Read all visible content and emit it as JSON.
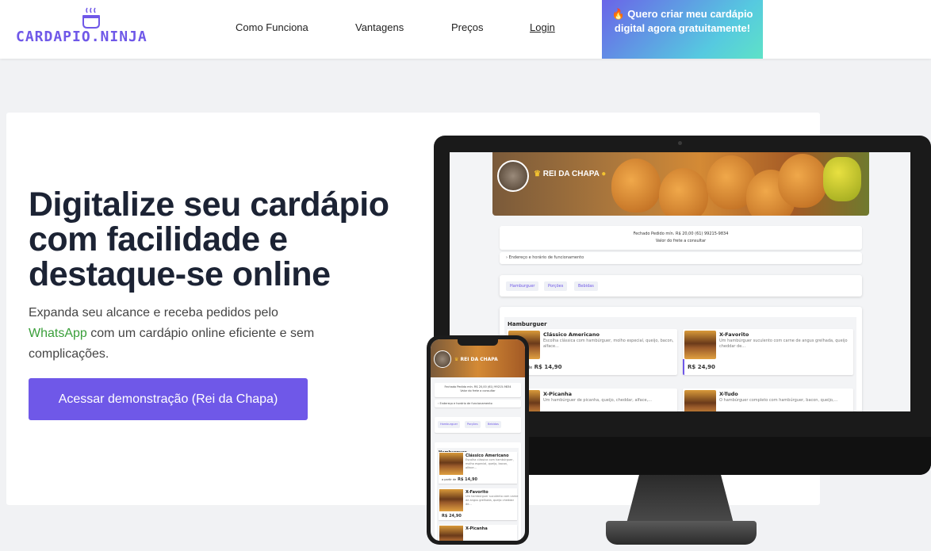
{
  "header": {
    "logo_text": "CARDAPIO.NINJA",
    "nav": [
      "Como Funciona",
      "Vantagens",
      "Preços",
      "Login"
    ],
    "cta": "Quero criar meu cardápio digital agora gratuitamente!"
  },
  "hero": {
    "title": "Digitalize seu cardápio com facilidade e destaque-se online",
    "subtitle_pre": "Expanda seu alcance e receba pedidos pelo ",
    "subtitle_highlight": "WhatsApp",
    "subtitle_post": " com um cardápio online eficiente e sem complicações.",
    "demo_button": "Acessar demonstração (Rei da Chapa)"
  },
  "preview": {
    "store_name": "REI DA CHAPA",
    "info_line": "Fechado  Pedido mín. R$ 20,00  (61) 99215-9834",
    "freight_line": "Valor do frete a consultar",
    "address_line": "Endereço e horário de funcionamento",
    "categories": [
      "Hamburguer",
      "Porções",
      "Bebidas"
    ],
    "section": "Hamburguer",
    "items": [
      {
        "name": "Clássico Americano",
        "desc": "Escolha clássica com hambúrguer, molho especial, queijo, bacon, alface...",
        "price": "R$ 14,90",
        "price_prefix": "a partir de"
      },
      {
        "name": "X-Favorito",
        "desc": "Um hambúrguer suculento com carne de angus grelhada, queijo cheddar de...",
        "price": "R$ 24,90"
      },
      {
        "name": "X-Picanha",
        "desc": "Um hambúrguer de picanha, queijo, cheddar, alface,...",
        "price": ""
      },
      {
        "name": "X-Tudo",
        "desc": "O hambúrguer completo com hambúrguer, bacon, queijo,...",
        "price": ""
      }
    ],
    "phone_items": [
      {
        "name": "Clássico Americano",
        "desc": "Escolha clássica com hambúrguer, molho especial, queijo, bacon, alface...",
        "price": "R$ 14,90",
        "price_prefix": "a partir de"
      },
      {
        "name": "X-Favorito",
        "desc": "Um hambúrguer suculento com carne de angus grelhada, queijo cheddar de...",
        "price": "R$ 24,90"
      },
      {
        "name": "X-Picanha",
        "desc": "",
        "price": ""
      }
    ]
  },
  "colors": {
    "brand": "#6f58e8",
    "whatsapp": "#3a9f3a",
    "title": "#1c2334"
  }
}
